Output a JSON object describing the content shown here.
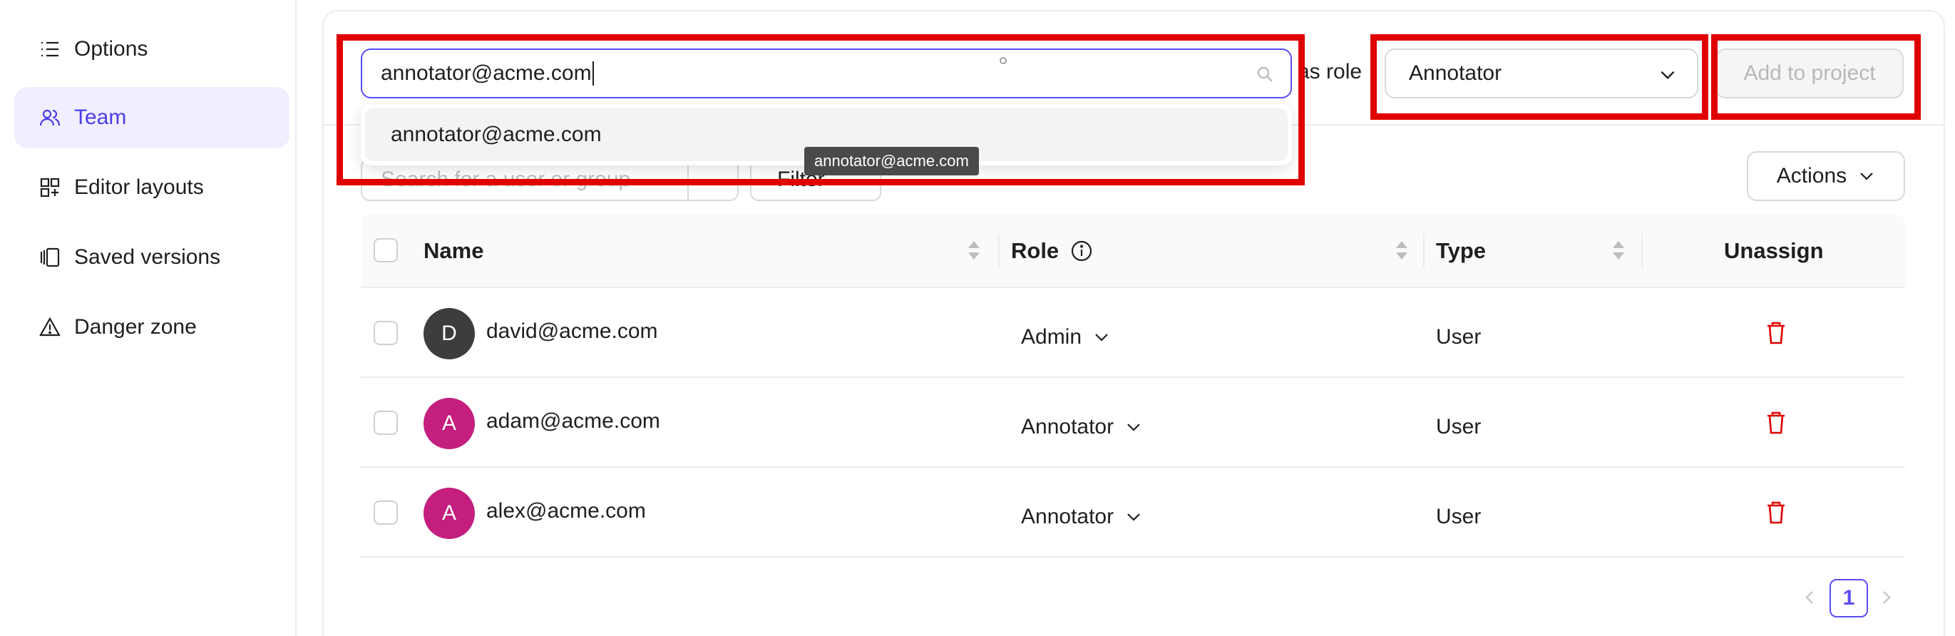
{
  "sidebar": {
    "items": [
      {
        "label": "Options",
        "icon": "list-icon"
      },
      {
        "label": "Team",
        "icon": "users-icon",
        "active": true
      },
      {
        "label": "Editor layouts",
        "icon": "layout-icon"
      },
      {
        "label": "Saved versions",
        "icon": "versions-icon"
      },
      {
        "label": "Danger zone",
        "icon": "warning-icon"
      }
    ]
  },
  "add_member": {
    "email_value": "annotator@acme.com",
    "as_role_label": "as role",
    "role_value": "Annotator",
    "add_button": "Add to project",
    "suggestions": [
      "annotator@acme.com"
    ],
    "tooltip": "annotator@acme.com"
  },
  "toolbar": {
    "search_placeholder": "Search for a user or group",
    "filter_label": "Filter",
    "actions_label": "Actions"
  },
  "table": {
    "columns": [
      "Name",
      "Role",
      "Type",
      "Unassign"
    ],
    "rows": [
      {
        "initial": "D",
        "email": "david@acme.com",
        "role": "Admin",
        "type": "User",
        "avatar_color": "#3d3d3d"
      },
      {
        "initial": "A",
        "email": "adam@acme.com",
        "role": "Annotator",
        "type": "User",
        "avatar_color": "#c41e7f"
      },
      {
        "initial": "A",
        "email": "alex@acme.com",
        "role": "Annotator",
        "type": "User",
        "avatar_color": "#c41e7f"
      }
    ]
  },
  "pagination": {
    "current": "1"
  },
  "colors": {
    "accent": "#5b4df0",
    "danger": "#e00000",
    "highlight": "#e00000"
  }
}
